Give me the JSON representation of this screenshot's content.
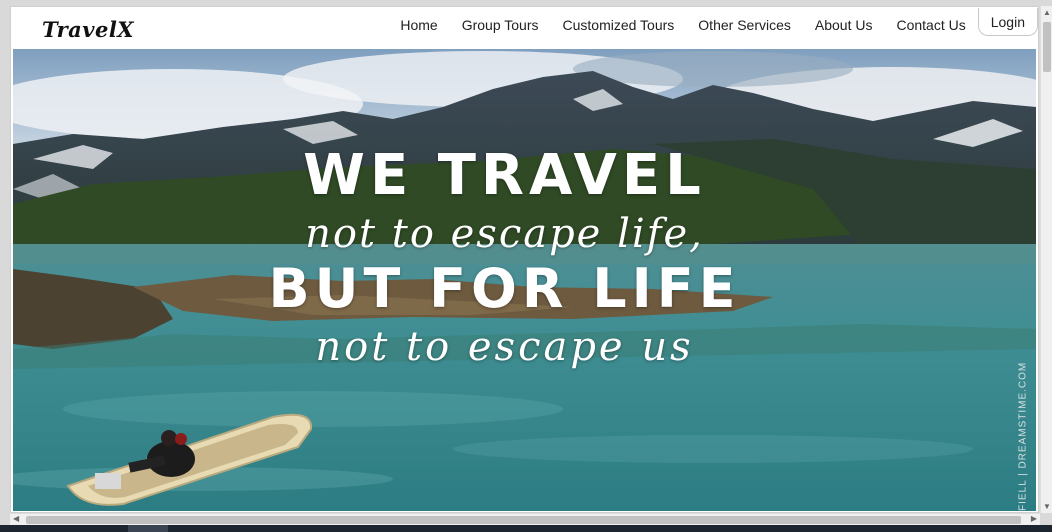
{
  "brand": {
    "logo_text": "TravelX"
  },
  "nav": {
    "items": [
      {
        "label": "Home"
      },
      {
        "label": "Group Tours"
      },
      {
        "label": "Customized Tours"
      },
      {
        "label": "Other Services"
      },
      {
        "label": "About Us"
      },
      {
        "label": "Contact Us"
      },
      {
        "label": "Login"
      }
    ]
  },
  "hero": {
    "line1": "WE TRAVEL",
    "line2": "not to escape life,",
    "line3": "BUT FOR LIFE",
    "line4": "not to escape us",
    "watermark": "FIELL | DREAMSTIME.COM"
  },
  "colors": {
    "water": "#3a8a8e",
    "sky": "#a9c3d8",
    "mountain": "#3b4a57",
    "forest": "#2f4a25",
    "boat": "#e8dbb4"
  },
  "icons": {
    "scroll_up": "triangle-up-icon",
    "scroll_down": "triangle-down-icon",
    "scroll_left": "triangle-left-icon",
    "scroll_right": "triangle-right-icon"
  }
}
